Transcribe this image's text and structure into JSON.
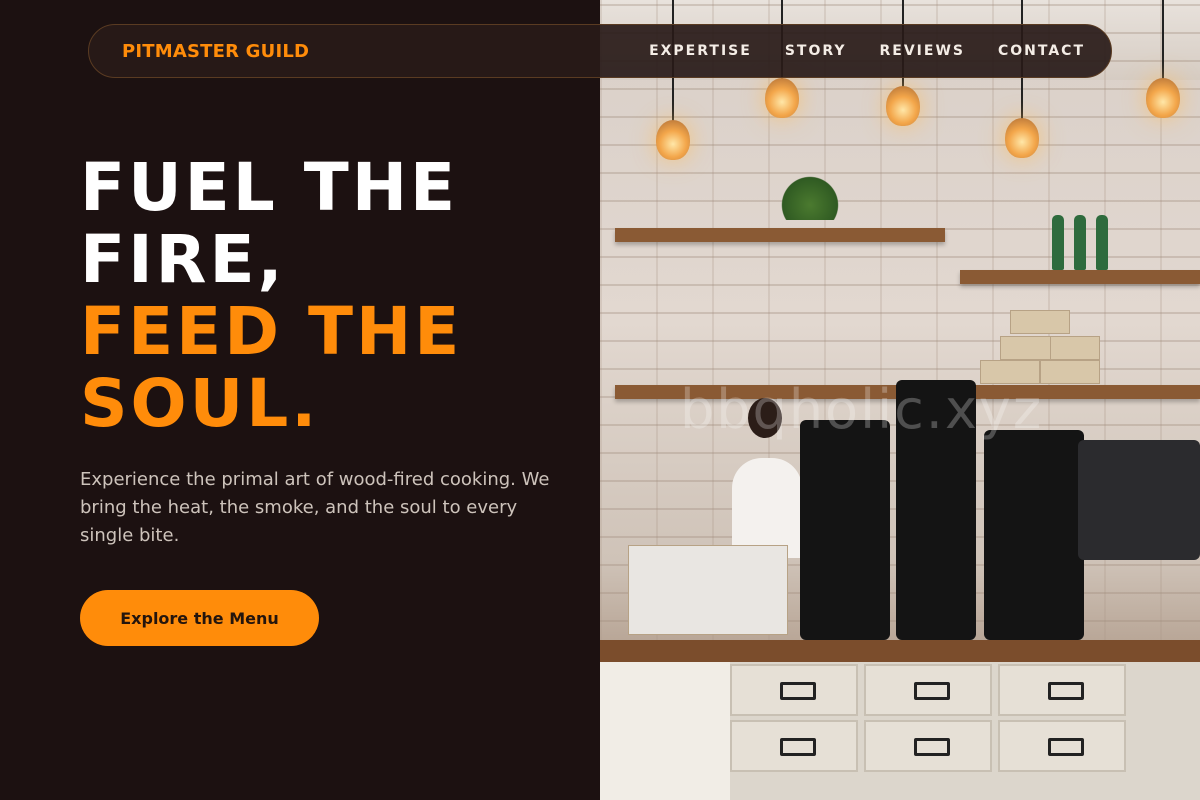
{
  "nav": {
    "logo": "PITMASTER GUILD",
    "links": [
      "EXPERTISE",
      "STORY",
      "REVIEWS",
      "CONTACT"
    ]
  },
  "hero": {
    "title_lines": [
      "FUEL THE",
      "FIRE,",
      "FEED THE",
      "SOUL."
    ],
    "subtitle": "Experience the primal art of wood-fired cooking. We bring the heat, the smoke, and the soul to every single bite.",
    "cta_label": "Explore the Menu"
  },
  "photo": {
    "watermark": "bbqholic.xyz",
    "subject": "cafe counter with hanging bulbs, shelves, coffee grinders and drawers"
  },
  "colors": {
    "background": "#1c1111",
    "accent": "#ff8c0a",
    "text_primary": "#ffffff",
    "text_secondary": "#cdc3bb"
  }
}
